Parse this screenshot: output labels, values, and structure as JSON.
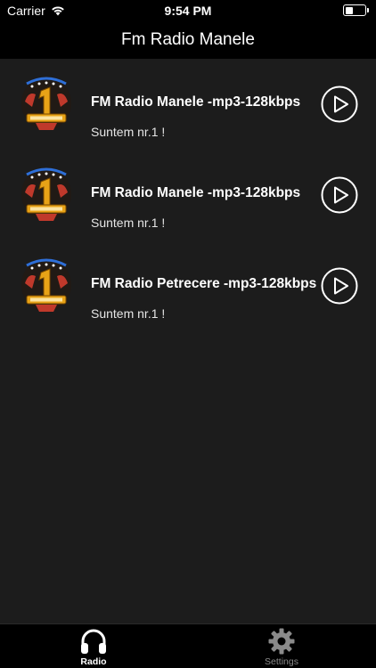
{
  "status_bar": {
    "carrier": "Carrier",
    "time": "9:54 PM",
    "wifi_icon": "wifi-icon",
    "battery_icon": "battery-icon"
  },
  "nav": {
    "title": "Fm Radio Manele"
  },
  "stations": [
    {
      "title": "FM Radio Manele -mp3-128kbps",
      "subtitle": "Suntem nr.1 !",
      "logo_icon": "station-logo-icon",
      "action_icon": "play-icon"
    },
    {
      "title": "FM Radio Manele -mp3-128kbps",
      "subtitle": "Suntem nr.1 !",
      "logo_icon": "station-logo-icon",
      "action_icon": "play-icon"
    },
    {
      "title": "FM Radio Petrecere -mp3-128kbps",
      "subtitle": "Suntem nr.1 !",
      "logo_icon": "station-logo-icon",
      "action_icon": "play-icon"
    }
  ],
  "tab_bar": {
    "tabs": [
      {
        "label": "Radio",
        "icon": "headphones-icon",
        "selected": true
      },
      {
        "label": "Settings",
        "icon": "gear-icon",
        "selected": false
      }
    ]
  },
  "colors": {
    "background": "#1c1c1c",
    "bars": "#000000",
    "text": "#ffffff",
    "inactive_tab": "#8a8a8a",
    "logo_gold": "#e8a317",
    "logo_red": "#c0392b",
    "logo_blue": "#2e6fd8"
  }
}
